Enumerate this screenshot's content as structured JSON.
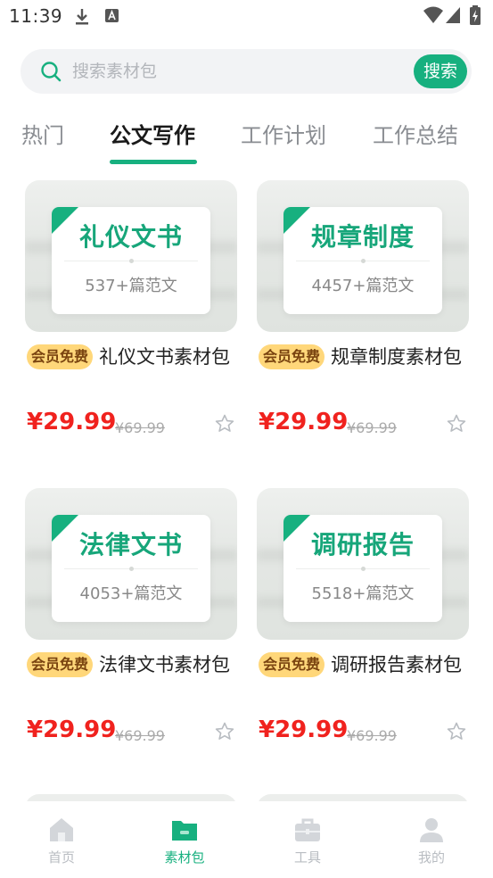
{
  "status_bar": {
    "time": "11:39"
  },
  "search": {
    "placeholder": "搜索素材包",
    "button_label": "搜索"
  },
  "tabs": [
    {
      "label": "热门",
      "active": false
    },
    {
      "label": "公文写作",
      "active": true
    },
    {
      "label": "工作计划",
      "active": false
    },
    {
      "label": "工作总结",
      "active": false
    }
  ],
  "cards": [
    {
      "thumb_title": "礼仪文书",
      "count": "537+篇范文",
      "badge": "会员免费",
      "title": "礼仪文书素材包",
      "price": "¥29.99",
      "old_price": "¥69.99"
    },
    {
      "thumb_title": "规章制度",
      "count": "4457+篇范文",
      "badge": "会员免费",
      "title": "规章制度素材包",
      "price": "¥29.99",
      "old_price": "¥69.99"
    },
    {
      "thumb_title": "法律文书",
      "count": "4053+篇范文",
      "badge": "会员免费",
      "title": "法律文书素材包",
      "price": "¥29.99",
      "old_price": "¥69.99"
    },
    {
      "thumb_title": "调研报告",
      "count": "5518+篇范文",
      "badge": "会员免费",
      "title": "调研报告素材包",
      "price": "¥29.99",
      "old_price": "¥69.99"
    }
  ],
  "bottom_nav": [
    {
      "label": "首页",
      "icon": "home-icon",
      "active": false
    },
    {
      "label": "素材包",
      "icon": "folder-icon",
      "active": true
    },
    {
      "label": "工具",
      "icon": "toolbox-icon",
      "active": false
    },
    {
      "label": "我的",
      "icon": "user-icon",
      "active": false
    }
  ],
  "colors": {
    "accent": "#17b07f",
    "price": "#f0221e",
    "badge_bg": "#ffd77a",
    "badge_text": "#7a4410"
  }
}
